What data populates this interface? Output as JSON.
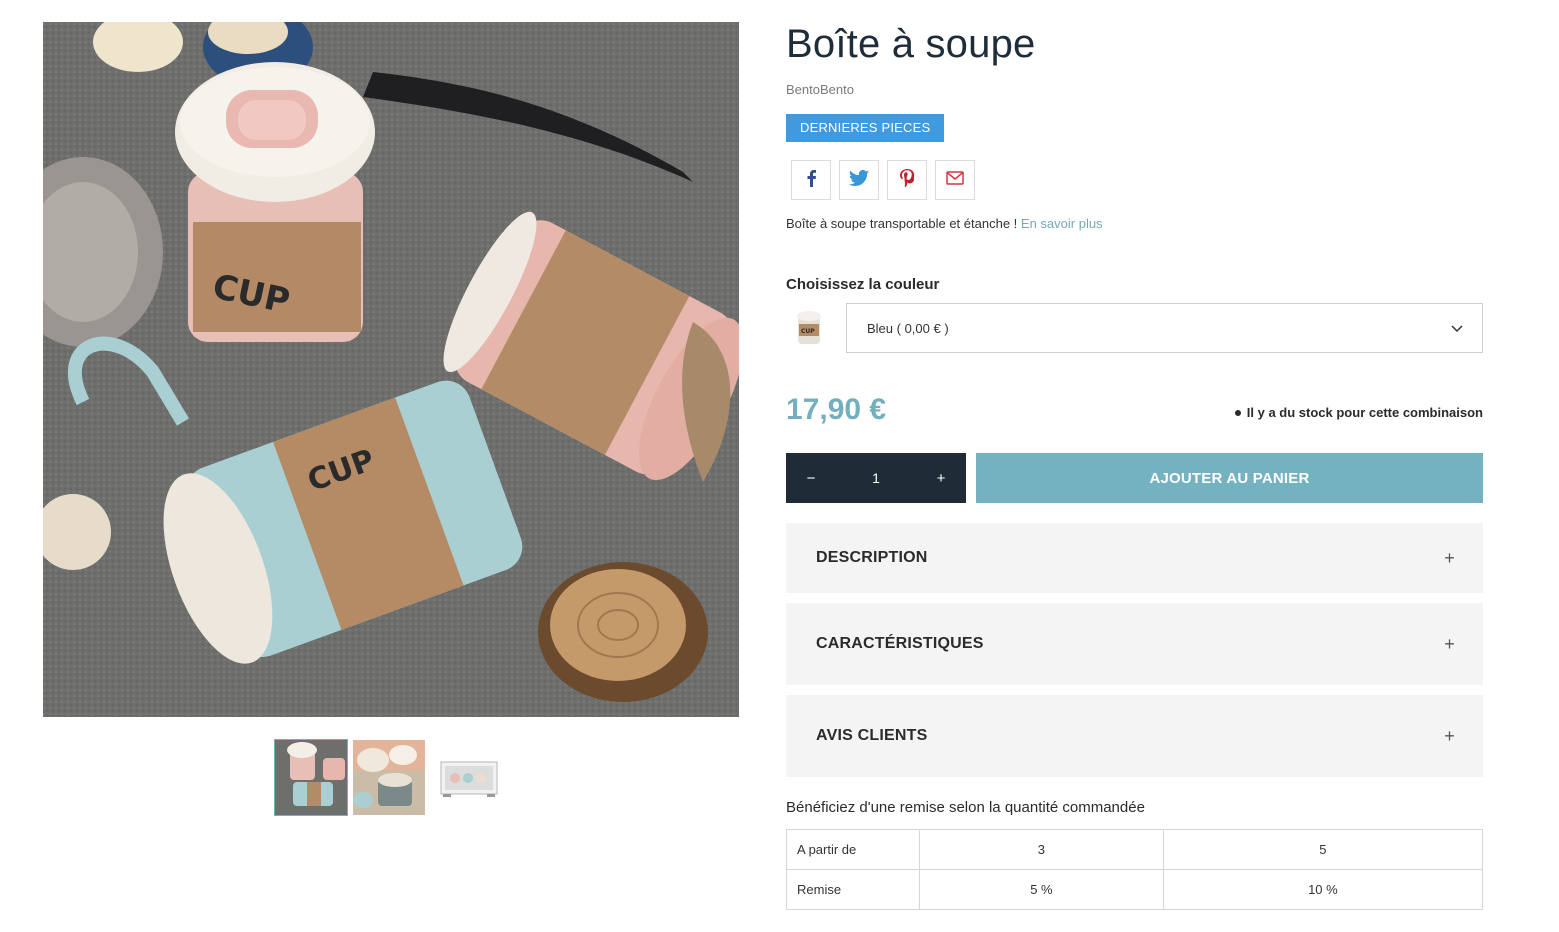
{
  "product": {
    "title": "Boîte à soupe",
    "brand": "BentoBento",
    "badge": "DERNIERES PIECES",
    "summary": "Boîte à soupe transportable et étanche !",
    "read_more": "En savoir plus",
    "price": "17,90 €",
    "stock_status": "Il y a du stock pour cette combinaison"
  },
  "share": {
    "icons": [
      "facebook-icon",
      "twitter-icon",
      "pinterest-icon",
      "email-icon"
    ]
  },
  "variant": {
    "label": "Choisissez la couleur",
    "selected": "Bleu ( 0,00 € )"
  },
  "cart": {
    "minus": "−",
    "quantity": "1",
    "plus": "+",
    "add_label": "AJOUTER AU PANIER"
  },
  "accordion": {
    "description": "DESCRIPTION",
    "features": "CARACTÉRISTIQUES",
    "reviews": "AVIS CLIENTS",
    "toggle": "+"
  },
  "discount": {
    "title": "Bénéficiez d'une remise selon la quantité commandée",
    "row_from_label": "A partir de",
    "row_discount_label": "Remise",
    "quantities": [
      "3",
      "5"
    ],
    "discounts": [
      "5 %",
      "10 %"
    ]
  },
  "colors": {
    "accent": "#74b2c0",
    "badge": "#3f9ae0",
    "dark": "#1f2b36",
    "price": "#74afbd"
  }
}
